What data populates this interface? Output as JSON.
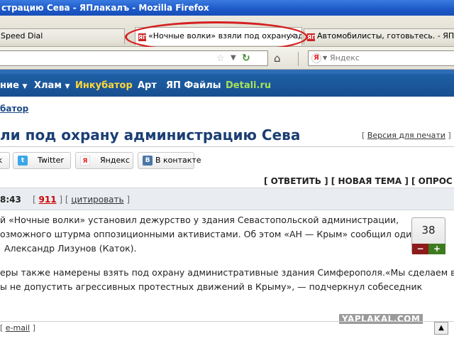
{
  "window": {
    "title": "страцию Сева - ЯПлакалъ - Mozilla Firefox"
  },
  "tabs": [
    {
      "label": "Speed Dial"
    },
    {
      "label": "«Ночные волки» взяли под охрану ад...",
      "favicon": "ЯП"
    },
    {
      "label": "Автомобилисты, готовьтесь. - ЯПлакалъ",
      "favicon": "ЯП"
    }
  ],
  "nav": {
    "search_placeholder": "Яндекс"
  },
  "menu": {
    "items": [
      "ние",
      "Хлам",
      "Инкубатор",
      "Арт",
      "ЯП Файлы",
      "Detali.ru"
    ]
  },
  "breadcrumb": "батор",
  "page_title": "ли под охрану администрацию Сева",
  "print_link": "Версия для печати",
  "share": [
    {
      "label": "ok",
      "icon": "facebook-icon"
    },
    {
      "label": "Twitter",
      "icon": "twitter-icon"
    },
    {
      "label": "Яндекс",
      "icon": "yandex-icon"
    },
    {
      "label": "В контакте",
      "icon": "vk-icon"
    }
  ],
  "post_actions": "[ ОТВЕТИТЬ ] [ НОВАЯ ТЕМА ] [ ОПРОС ]",
  "post": {
    "time": "8:43",
    "number": "911",
    "quote_label": "цитировать",
    "lines": [
      "й «Ночные волки» установил дежурство у здания Севастопольской администрации,",
      "озможного штурма оппозиционными активистами. Об этом «АН — Крым» сообщил один",
      "Александр Лизунов (Каток).",
      "",
      "еры также намерены взять под охрану административные здания Симферополя.«Мы сделаем все",
      "ы не допустить агрессивных протестных движений в Крыму», — подчеркнул собеседник"
    ]
  },
  "rating": {
    "value": "38",
    "minus": "−",
    "plus": "+"
  },
  "footer": {
    "email_label": "e-mail"
  },
  "watermark": "YAPLAKAL.COM"
}
